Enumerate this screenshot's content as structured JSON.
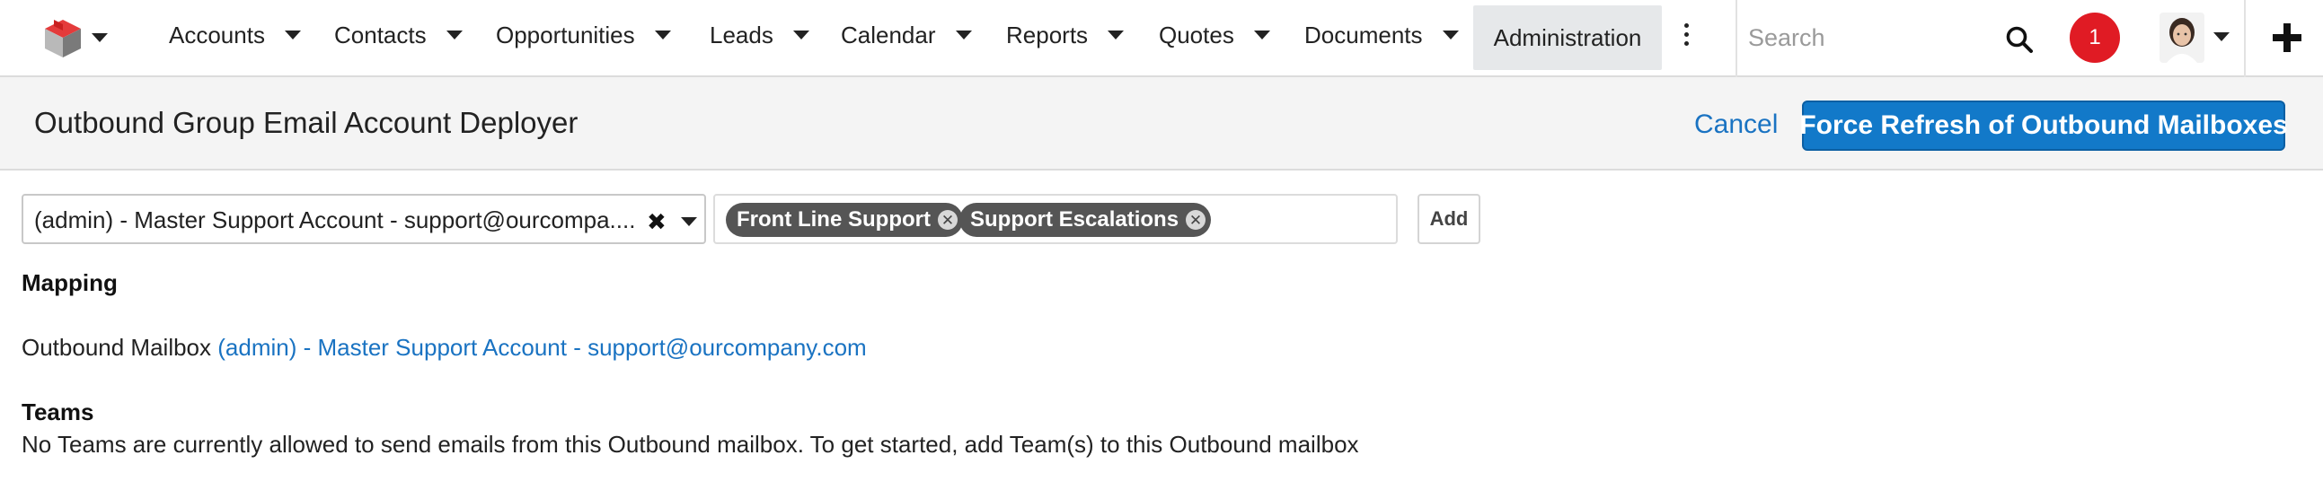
{
  "nav": {
    "items": [
      {
        "label": "Accounts"
      },
      {
        "label": "Contacts"
      },
      {
        "label": "Opportunities"
      },
      {
        "label": "Leads"
      },
      {
        "label": "Calendar"
      },
      {
        "label": "Reports"
      },
      {
        "label": "Quotes"
      },
      {
        "label": "Documents"
      }
    ],
    "active_label": "Administration",
    "search_placeholder": "Search",
    "notification_count": "1"
  },
  "header": {
    "title": "Outbound Group Email Account Deployer",
    "cancel_label": "Cancel",
    "refresh_label": "Force Refresh of Outbound Mailboxes"
  },
  "form": {
    "selected_account": "(admin) - Master Support Account - support@ourcompany.com",
    "teams": [
      "Front Line Support",
      "Support Escalations"
    ],
    "add_label": "Add"
  },
  "mapping": {
    "heading": "Mapping",
    "outbound_label": "Outbound Mailbox",
    "outbound_link": "(admin) - Master Support Account - support@ourcompany.com",
    "teams_heading": "Teams",
    "teams_message": "No Teams are currently allowed to send emails from this Outbound mailbox. To get started, add Team(s) to this Outbound mailbox"
  },
  "colors": {
    "accent": "#1279c9",
    "link": "#1a73c2",
    "badge": "#e01b24",
    "pill": "#555555"
  }
}
